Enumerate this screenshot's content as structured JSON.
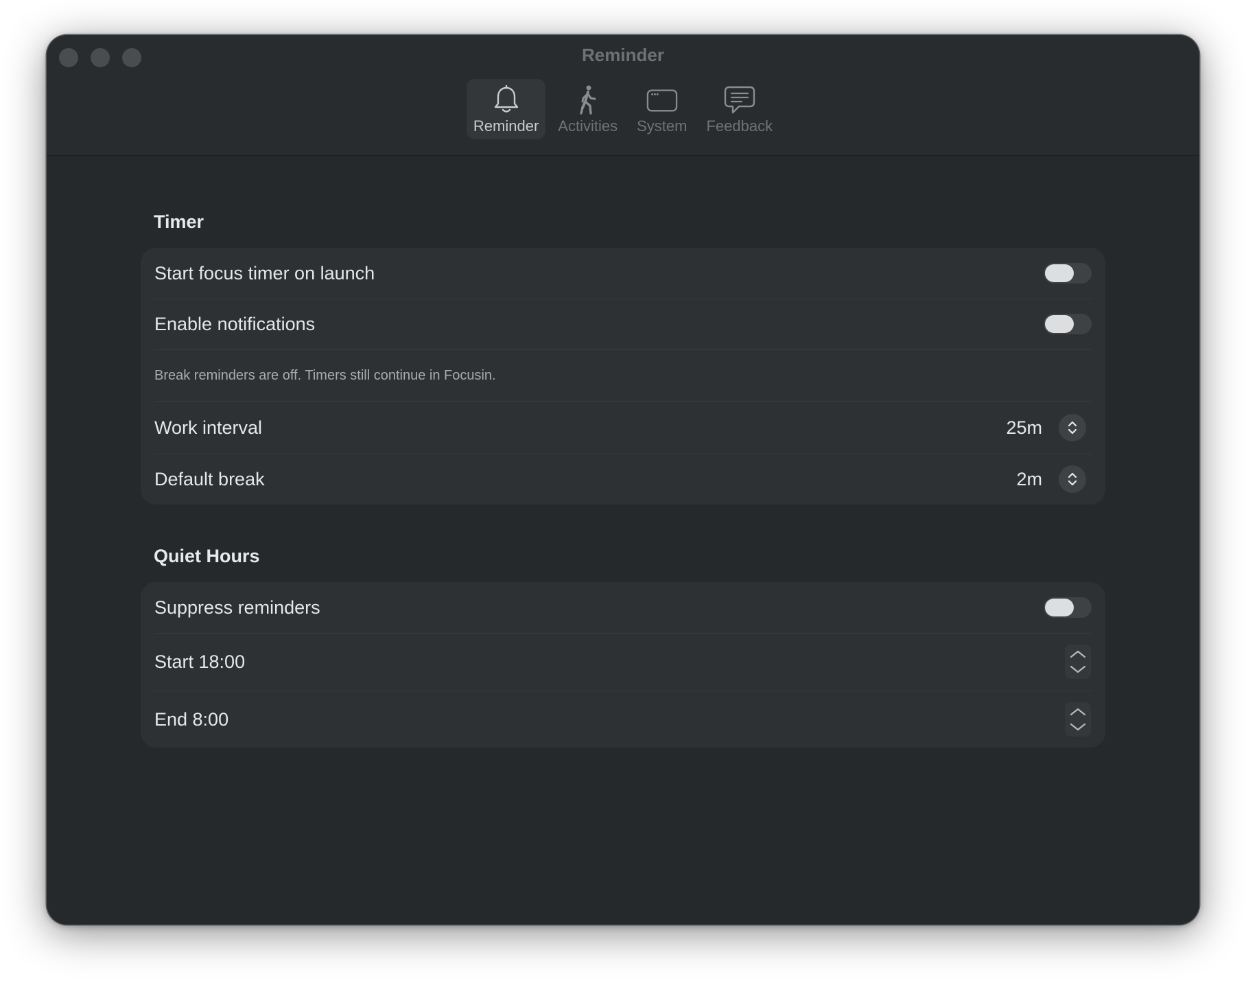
{
  "window": {
    "title": "Reminder"
  },
  "tabs": [
    {
      "label": "Reminder",
      "icon": "bell-icon",
      "active": true
    },
    {
      "label": "Activities",
      "icon": "walking-person-icon",
      "active": false
    },
    {
      "label": "System",
      "icon": "window-icon",
      "active": false
    },
    {
      "label": "Feedback",
      "icon": "chat-bubble-icon",
      "active": false
    }
  ],
  "timer": {
    "title": "Timer",
    "start_focus_label": "Start focus timer on launch",
    "start_focus_on": false,
    "notifications_label": "Enable notifications",
    "notifications_on": false,
    "note": "Break reminders are off. Timers still continue in Focusin.",
    "work_interval_label": "Work interval",
    "work_interval_value": "25m",
    "default_break_label": "Default break",
    "default_break_value": "2m"
  },
  "quiet_hours": {
    "title": "Quiet Hours",
    "suppress_label": "Suppress reminders",
    "suppress_on": false,
    "start_label": "Start 18:00",
    "end_label": "End 8:00"
  },
  "colors": {
    "window_bg": "#26292b",
    "card_bg": "#2d3133",
    "text": "#e6e7e8",
    "muted": "#6f7376"
  }
}
